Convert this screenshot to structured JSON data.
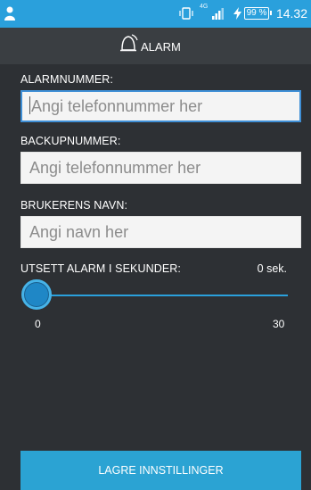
{
  "status_bar": {
    "network_label": "4G",
    "battery_percent": "99 %",
    "time": "14.32"
  },
  "header": {
    "title": "ALARM"
  },
  "form": {
    "alarm_number": {
      "label": "ALARMNUMMER:",
      "placeholder": "Angi telefonnummer her"
    },
    "backup_number": {
      "label": "BACKUPNUMMER:",
      "placeholder": "Angi telefonnummer her"
    },
    "user_name": {
      "label": "BRUKERENS NAVN:",
      "placeholder": "Angi navn her"
    },
    "delay": {
      "label": "UTSETT ALARM I SEKUNDER:",
      "value_text": "0 sek.",
      "min_label": "0",
      "max_label": "30",
      "value": 0,
      "min": 0,
      "max": 30
    }
  },
  "save_button": {
    "label": "LAGRE INNSTILLINGER"
  },
  "colors": {
    "accent": "#2aa0dc",
    "background": "#2d3034",
    "header": "#3a3e42"
  }
}
